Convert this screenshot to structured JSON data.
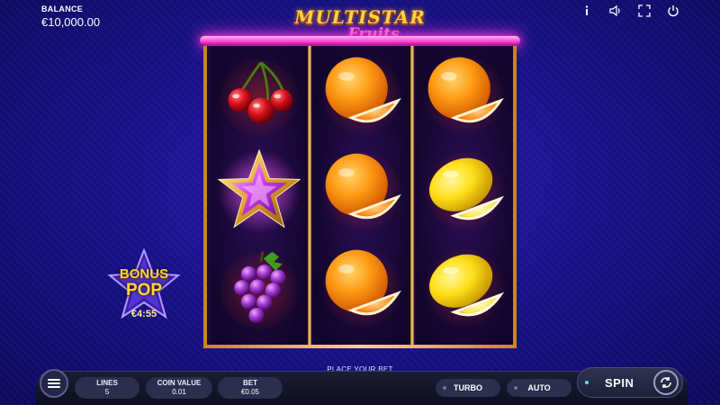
{
  "balance": {
    "label": "BALANCE",
    "value": "€10,000.00"
  },
  "logo": {
    "line1": "MULTISTAR",
    "line2": "Fruits"
  },
  "top_icons": [
    "info-icon",
    "sound-icon",
    "fullscreen-icon",
    "power-icon"
  ],
  "reels": [
    [
      "cherry",
      "star",
      "grapes"
    ],
    [
      "orange",
      "orange",
      "orange"
    ],
    [
      "orange",
      "lemon",
      "lemon"
    ]
  ],
  "bonus": {
    "line1": "BONUS",
    "line2": "POP",
    "timer": "€4:55"
  },
  "bottom": {
    "prompt": "PLACE YOUR BET",
    "lines": {
      "label": "LINES",
      "value": "5"
    },
    "coin_value": {
      "label": "COIN VALUE",
      "value": "0.01"
    },
    "bet": {
      "label": "BET",
      "value": "€0.05"
    },
    "turbo_label": "TURBO",
    "auto_label": "AUTO",
    "spin_label": "SPIN"
  },
  "colors": {
    "neon": "#ff45d4",
    "gold": "#c9861d",
    "spin_dot": "#4df0c8"
  }
}
